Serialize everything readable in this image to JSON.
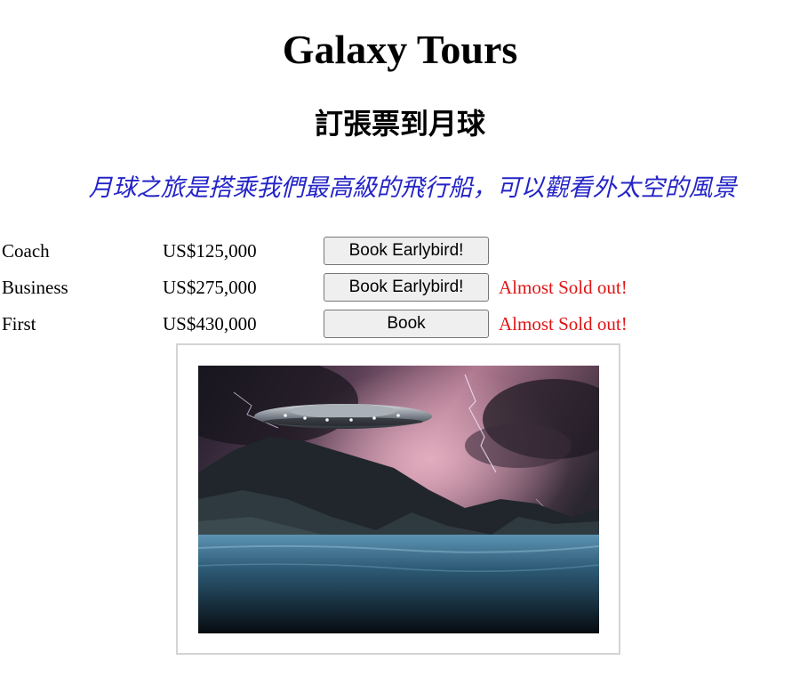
{
  "header": {
    "title": "Galaxy Tours",
    "subtitle": "訂張票到月球",
    "tagline": "月球之旅是搭乘我們最高級的飛行船，可以觀看外太空的風景"
  },
  "tickets": [
    {
      "class": "Coach",
      "price": "US$125,000",
      "button": "Book Earlybird!",
      "notice": ""
    },
    {
      "class": "Business",
      "price": "US$275,000",
      "button": "Book Earlybird!",
      "notice": "Almost Sold out!"
    },
    {
      "class": "First",
      "price": "US$430,000",
      "button": "Book",
      "notice": "Almost Sold out!"
    }
  ],
  "colors": {
    "tagline": "#2424c8",
    "notice": "#e01515"
  }
}
